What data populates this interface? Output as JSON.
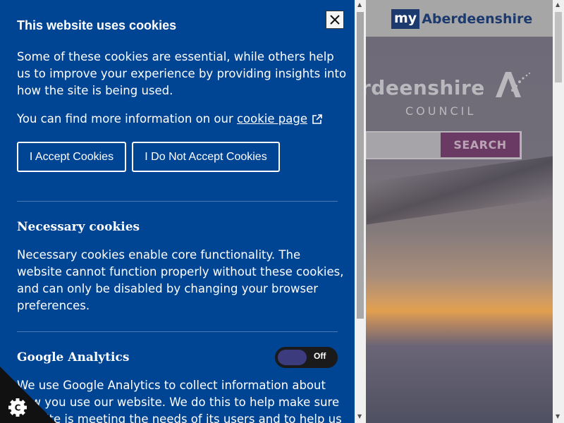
{
  "site": {
    "logo_my": "my",
    "logo_name": "Aberdeenshire",
    "council_word": "rdeenshire",
    "council_sub": "COUNCIL",
    "search_button": "SEARCH"
  },
  "cookie_panel": {
    "title": "This website uses cookies",
    "intro": "Some of these cookies are essential, while others help us to improve your experience by providing insights into how the site is being used.",
    "more_prefix": "You can find more information on our ",
    "more_link": "cookie page",
    "accept_label": "I Accept Cookies",
    "reject_label": "I Do Not Accept Cookies",
    "necessary": {
      "title": "Necessary cookies",
      "text": "Necessary cookies enable core functionality. The website cannot function properly without these cookies, and can only be disabled by changing your browser preferences."
    },
    "analytics": {
      "title": "Google Analytics",
      "toggle_label": "Off",
      "toggle_state": "off",
      "text": "We use Google Analytics to collect information about how you use our website. We do this to help make sure the site is meeting the needs of its users and to help us"
    }
  },
  "icons": {
    "close": "close-icon",
    "external_link": "external-link-icon",
    "cookie_settings": "cookie-settings-icon"
  },
  "colors": {
    "panel_bg": "#004494",
    "brand_navy": "#1c3a6e",
    "search_purple": "#6b3a64",
    "toggle_knob": "#3b3b7d"
  }
}
